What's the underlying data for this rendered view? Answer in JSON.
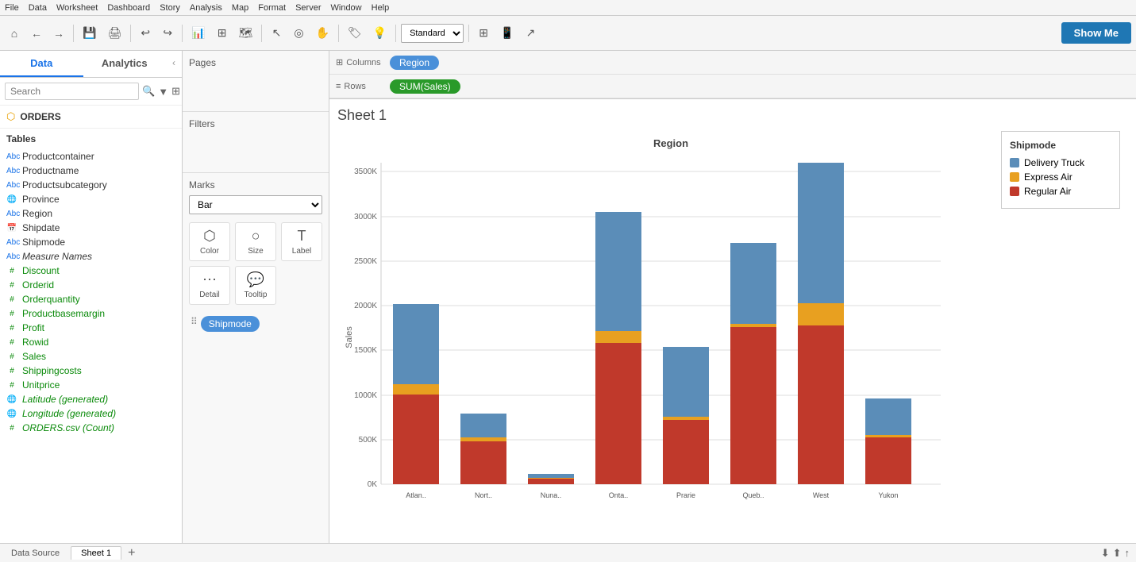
{
  "menubar": {
    "items": [
      "File",
      "Data",
      "Worksheet",
      "Dashboard",
      "Story",
      "Analysis",
      "Map",
      "Format",
      "Server",
      "Window",
      "Help"
    ]
  },
  "toolbar": {
    "standard_label": "Standard",
    "show_me_label": "Show Me"
  },
  "left_panel": {
    "tab_data": "Data",
    "tab_analytics": "Analytics",
    "search_placeholder": "Search",
    "datasource_name": "ORDERS",
    "tables_header": "Tables",
    "fields": [
      {
        "name": "Productcontainer",
        "type": "abc",
        "kind": "dimension"
      },
      {
        "name": "Productname",
        "type": "abc",
        "kind": "dimension"
      },
      {
        "name": "Productsubcategory",
        "type": "abc",
        "kind": "dimension"
      },
      {
        "name": "Province",
        "type": "geo",
        "kind": "dimension"
      },
      {
        "name": "Region",
        "type": "abc",
        "kind": "dimension"
      },
      {
        "name": "Shipdate",
        "type": "cal",
        "kind": "dimension"
      },
      {
        "name": "Shipmode",
        "type": "abc",
        "kind": "dimension"
      },
      {
        "name": "Measure Names",
        "type": "abc",
        "kind": "dimension",
        "italic": true
      },
      {
        "name": "Discount",
        "type": "#",
        "kind": "measure"
      },
      {
        "name": "Orderid",
        "type": "#",
        "kind": "measure"
      },
      {
        "name": "Orderquantity",
        "type": "#",
        "kind": "measure"
      },
      {
        "name": "Productbasemargin",
        "type": "#",
        "kind": "measure"
      },
      {
        "name": "Profit",
        "type": "#",
        "kind": "measure"
      },
      {
        "name": "Rowid",
        "type": "#",
        "kind": "measure"
      },
      {
        "name": "Sales",
        "type": "#",
        "kind": "measure"
      },
      {
        "name": "Shippingcosts",
        "type": "#",
        "kind": "measure"
      },
      {
        "name": "Unitprice",
        "type": "#",
        "kind": "measure"
      },
      {
        "name": "Latitude (generated)",
        "type": "geo",
        "kind": "measure",
        "italic": true
      },
      {
        "name": "Longitude (generated)",
        "type": "geo",
        "kind": "measure",
        "italic": true
      },
      {
        "name": "ORDERS.csv (Count)",
        "type": "#",
        "kind": "measure",
        "italic": true
      }
    ]
  },
  "pages_panel": {
    "title": "Pages"
  },
  "filters_panel": {
    "title": "Filters"
  },
  "marks_panel": {
    "title": "Marks",
    "type": "Bar",
    "buttons": [
      {
        "label": "Color",
        "icon": "⬡"
      },
      {
        "label": "Size",
        "icon": "○"
      },
      {
        "label": "Label",
        "icon": "T"
      },
      {
        "label": "Detail",
        "icon": "⋯"
      },
      {
        "label": "Tooltip",
        "icon": "💬"
      }
    ],
    "pill_label": "Shipmode"
  },
  "shelves": {
    "columns_label": "Columns",
    "columns_pill": "Region",
    "rows_label": "Rows",
    "rows_pill": "SUM(Sales)"
  },
  "chart": {
    "title": "Sheet 1",
    "x_label": "Region",
    "y_label": "Sales",
    "regions": [
      "Atlan..",
      "Nort..",
      "Nuna..",
      "Onta..",
      "Prarie",
      "Queb..",
      "West",
      "Yukon"
    ],
    "bars": [
      {
        "region": "Atlan..",
        "regular_air": 1000,
        "express_air": 120,
        "delivery_truck": 900
      },
      {
        "region": "Nort..",
        "regular_air": 480,
        "express_air": 50,
        "delivery_truck": 260
      },
      {
        "region": "Nuna..",
        "regular_air": 60,
        "express_air": 10,
        "delivery_truck": 40
      },
      {
        "region": "Onta..",
        "regular_air": 1580,
        "express_air": 130,
        "delivery_truck": 1330
      },
      {
        "region": "Prarie",
        "regular_air": 720,
        "express_air": 40,
        "delivery_truck": 780
      },
      {
        "region": "Queb..",
        "regular_air": 1760,
        "express_air": 40,
        "delivery_truck": 900
      },
      {
        "region": "West",
        "regular_air": 1780,
        "express_air": 250,
        "delivery_truck": 1570
      },
      {
        "region": "Yukon",
        "regular_air": 520,
        "express_air": 30,
        "delivery_truck": 410
      }
    ],
    "y_ticks": [
      "0K",
      "500K",
      "1000K",
      "1500K",
      "2000K",
      "2500K",
      "3000K",
      "3500K"
    ],
    "max_value": 3600
  },
  "legend": {
    "title": "Shipmode",
    "items": [
      {
        "label": "Delivery Truck",
        "color": "#5b8db8"
      },
      {
        "label": "Express Air",
        "color": "#e8a020"
      },
      {
        "label": "Regular Air",
        "color": "#c0392b"
      }
    ]
  },
  "status_bar": {
    "datasource": "Data Source",
    "sheet": "Sheet 1",
    "plus_icon": "+"
  }
}
